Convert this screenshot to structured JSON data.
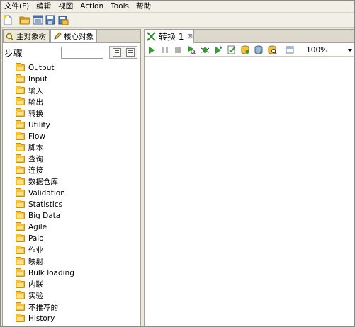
{
  "menu": {
    "items": [
      {
        "label": "文件(F)"
      },
      {
        "label": "编辑"
      },
      {
        "label": "视图"
      },
      {
        "label": "Action"
      },
      {
        "label": "Tools"
      },
      {
        "label": "帮助"
      }
    ]
  },
  "toolbar": {
    "icons": [
      "new-file-icon",
      "open-folder-icon",
      "explore-icon",
      "save-icon",
      "save-as-icon"
    ]
  },
  "left_panel": {
    "tabs": [
      {
        "label": "主对象树",
        "icon": "search-tree-icon",
        "active": false
      },
      {
        "label": "核心对象",
        "icon": "pencil-icon",
        "active": true
      }
    ],
    "steps_title": "步骤",
    "search": {
      "value": "",
      "placeholder": ""
    },
    "tree_items": [
      {
        "label": "Output"
      },
      {
        "label": "Input"
      },
      {
        "label": "输入"
      },
      {
        "label": "输出"
      },
      {
        "label": "转换"
      },
      {
        "label": "Utility"
      },
      {
        "label": "Flow"
      },
      {
        "label": "脚本"
      },
      {
        "label": "查询"
      },
      {
        "label": "连接"
      },
      {
        "label": "数据仓库"
      },
      {
        "label": "Validation"
      },
      {
        "label": "Statistics"
      },
      {
        "label": "Big Data"
      },
      {
        "label": "Agile"
      },
      {
        "label": "Palo"
      },
      {
        "label": "作业"
      },
      {
        "label": "映射"
      },
      {
        "label": "Bulk loading"
      },
      {
        "label": "内联"
      },
      {
        "label": "实验"
      },
      {
        "label": "不推荐的"
      },
      {
        "label": "History"
      }
    ]
  },
  "right_panel": {
    "tab": {
      "label": "转换 1",
      "close": "⊠",
      "icon": "transform-icon"
    },
    "toolbar_icons": [
      "run-icon",
      "pause-icon",
      "stop-icon",
      "preview-icon",
      "debug-icon",
      "replay-icon",
      "verify-icon",
      "analyze-icon",
      "sql-icon",
      "explore-db-icon",
      "show-results-icon"
    ],
    "zoom": "100%"
  },
  "colors": {
    "folder": "#f2c33a",
    "run_green": "#2e9e2e",
    "frame_bg": "#ece9d8"
  }
}
